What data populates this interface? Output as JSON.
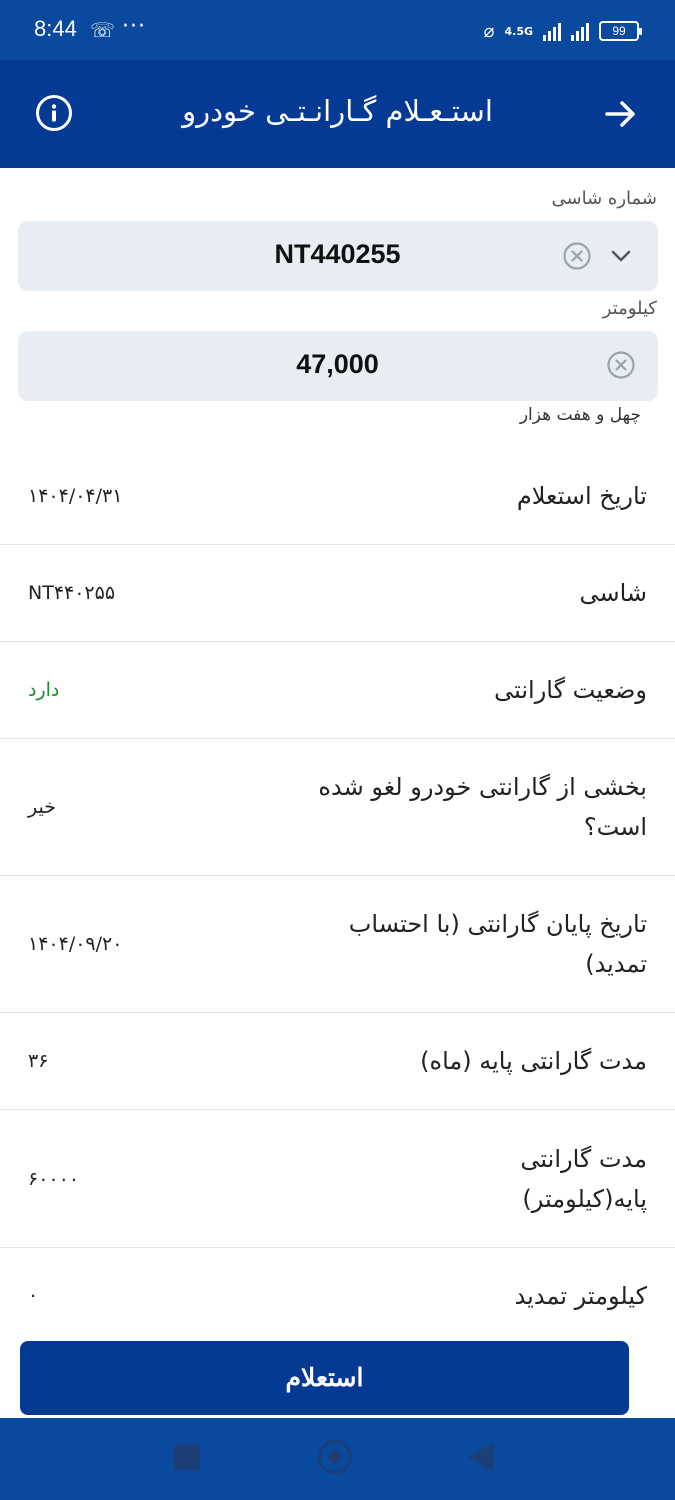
{
  "status_bar": {
    "time": "8:44",
    "missed_call_icon": "missed-call-icon",
    "more": "···",
    "network": "4.5G",
    "battery": "99"
  },
  "header": {
    "title": "استـعـلام گـارانـتـی خودرو",
    "info_icon": "info-icon",
    "back_icon": "arrow-right-icon"
  },
  "form": {
    "chassis_label": "شماره شاسی",
    "chassis_value": "NT440255",
    "km_label": "کیلومتر",
    "km_value": "47,000",
    "km_words": "چهل و هفت هزار"
  },
  "results": [
    {
      "label": "تاریخ استعلام",
      "value": "۱۴۰۴/۰۴/۳۱"
    },
    {
      "label": "شاسی",
      "value": "NT۴۴۰۲۵۵"
    },
    {
      "label": "وضعیت گارانتی",
      "value": "دارد"
    },
    {
      "label": "بخشی از گارانتی خودرو لغو شده است؟",
      "value": "خیر"
    },
    {
      "label": "تاریخ پایان گارانتی (با احتساب تمدید)",
      "value": "۱۴۰۴/۰۹/۲۰"
    },
    {
      "label": "مدت گارانتی پایه (ماه)",
      "value": "۳۶"
    },
    {
      "label": "مدت گارانتی پایه(کیلومتر)",
      "value": "۶۰۰۰۰"
    },
    {
      "label": "کیلومتر تمدید",
      "value": "۰"
    }
  ],
  "actions": {
    "inquiry_button": "استعلام"
  },
  "colors": {
    "primary": "#053a94",
    "status_ok": "#1b8a2f",
    "field_bg": "#e8edf3"
  }
}
